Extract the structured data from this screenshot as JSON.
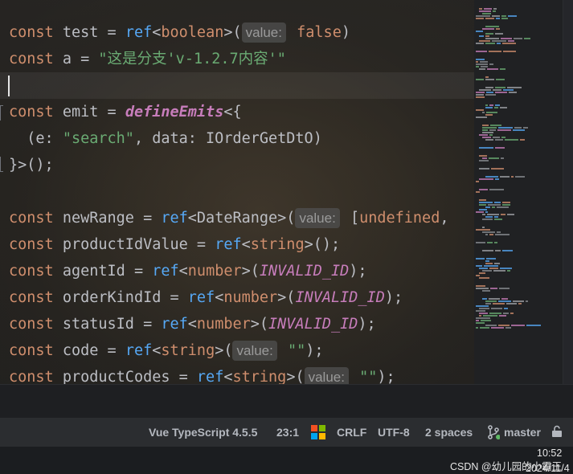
{
  "editor": {
    "lines": [
      {
        "tokens": [
          [
            "kw",
            "const"
          ],
          [
            "plain",
            " test = "
          ],
          [
            "fn",
            "ref"
          ],
          [
            "plain",
            "<"
          ],
          [
            "type",
            "boolean"
          ],
          [
            "plain",
            ">("
          ],
          [
            "hint",
            "value:"
          ],
          [
            "kw",
            " false"
          ],
          [
            "plain",
            ")"
          ]
        ]
      },
      {
        "tokens": [
          [
            "kw",
            "const"
          ],
          [
            "plain",
            " a = "
          ],
          [
            "str",
            "\"这是分支'v-1.2.7内容'\""
          ]
        ]
      },
      {
        "current": true,
        "tokens": []
      },
      {
        "gutter": "start",
        "tokens": [
          [
            "kw",
            "const"
          ],
          [
            "plain",
            " emit = "
          ],
          [
            "fn-it",
            "defineEmits"
          ],
          [
            "plain",
            "<{"
          ]
        ]
      },
      {
        "tokens": [
          [
            "plain",
            "  (e: "
          ],
          [
            "str",
            "\"search\""
          ],
          [
            "plain",
            ", data: IOrderGetDtO)"
          ]
        ]
      },
      {
        "gutter": "end",
        "tokens": [
          [
            "plain",
            "}>();"
          ]
        ]
      },
      {
        "tokens": []
      },
      {
        "tokens": [
          [
            "kw",
            "const"
          ],
          [
            "plain",
            " newRange = "
          ],
          [
            "fn",
            "ref"
          ],
          [
            "plain",
            "<DateRange>("
          ],
          [
            "hint",
            "value:"
          ],
          [
            "plain",
            " ["
          ],
          [
            "kw",
            "undefined"
          ],
          [
            "plain",
            ","
          ]
        ]
      },
      {
        "tokens": [
          [
            "kw",
            "const"
          ],
          [
            "plain",
            " productIdValue = "
          ],
          [
            "fn",
            "ref"
          ],
          [
            "plain",
            "<"
          ],
          [
            "type",
            "string"
          ],
          [
            "plain",
            ">();"
          ]
        ]
      },
      {
        "tokens": [
          [
            "kw",
            "const"
          ],
          [
            "plain",
            " agentId = "
          ],
          [
            "fn",
            "ref"
          ],
          [
            "plain",
            "<"
          ],
          [
            "type",
            "number"
          ],
          [
            "plain",
            ">("
          ],
          [
            "const-it",
            "INVALID_ID"
          ],
          [
            "plain",
            ");"
          ]
        ]
      },
      {
        "tokens": [
          [
            "kw",
            "const"
          ],
          [
            "plain",
            " orderKindId = "
          ],
          [
            "fn",
            "ref"
          ],
          [
            "plain",
            "<"
          ],
          [
            "type",
            "number"
          ],
          [
            "plain",
            ">("
          ],
          [
            "const-it",
            "INVALID_ID"
          ],
          [
            "plain",
            ");"
          ]
        ]
      },
      {
        "tokens": [
          [
            "kw",
            "const"
          ],
          [
            "plain",
            " statusId = "
          ],
          [
            "fn",
            "ref"
          ],
          [
            "plain",
            "<"
          ],
          [
            "type",
            "number"
          ],
          [
            "plain",
            ">("
          ],
          [
            "const-it",
            "INVALID_ID"
          ],
          [
            "plain",
            ");"
          ]
        ]
      },
      {
        "tokens": [
          [
            "kw",
            "const"
          ],
          [
            "plain",
            " code = "
          ],
          [
            "fn",
            "ref"
          ],
          [
            "plain",
            "<"
          ],
          [
            "type",
            "string"
          ],
          [
            "plain",
            ">("
          ],
          [
            "hint",
            "value:"
          ],
          [
            "str",
            " \"\""
          ],
          [
            "plain",
            ");"
          ]
        ]
      },
      {
        "tokens": [
          [
            "kw",
            "const"
          ],
          [
            "plain",
            " productCodes = "
          ],
          [
            "fn",
            "ref"
          ],
          [
            "plain",
            "<"
          ],
          [
            "type",
            "string"
          ],
          [
            "plain",
            ">("
          ],
          [
            "hint",
            "value:"
          ],
          [
            "str",
            " \"\""
          ],
          [
            "plain",
            ");"
          ]
        ]
      }
    ]
  },
  "statusbar": {
    "language": "Vue TypeScript 4.5.5",
    "position": "23:1",
    "line_ending": "CRLF",
    "encoding": "UTF-8",
    "indent": "2 spaces",
    "branch": "master"
  },
  "taskbar": {
    "time": "10:52",
    "date": "2024/11/4",
    "watermark": "CSDN @幼儿园的小霸王"
  },
  "colors": {
    "keyword": "#cf8e6d",
    "function": "#56a8f5",
    "string": "#6aab73",
    "constant": "#c77dbb",
    "text": "#bcbec4"
  }
}
